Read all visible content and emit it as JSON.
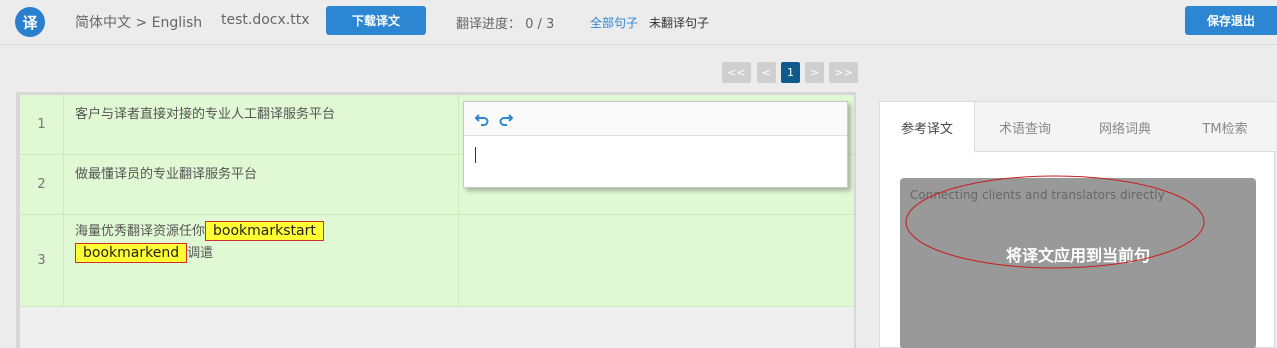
{
  "header": {
    "logo_char": "译",
    "lang_pair": "简体中文 > English",
    "filename": "test.docx.ttx",
    "download_label": "下载译文",
    "progress": "翻译进度： 0 / 3",
    "filter_all": "全部句子",
    "filter_untranslated": "未翻译句子",
    "save_exit_label": "保存退出"
  },
  "pagination": {
    "first": "<<",
    "prev": "<",
    "current": "1",
    "next": ">",
    "last": ">>"
  },
  "segments": [
    {
      "num": "1",
      "source": "客户与译者直接对接的专业人工翻译服务平台"
    },
    {
      "num": "2",
      "source": "做最懂译员的专业翻译服务平台"
    },
    {
      "num": "3",
      "source_before": "海量优秀翻译资源任你",
      "bookmark_start": "bookmarkstart",
      "bookmark_end": "bookmarkend",
      "source_after": "调遣"
    }
  ],
  "editor": {
    "undo_icon": "undo-icon",
    "redo_icon": "redo-icon"
  },
  "right_panel": {
    "tabs": [
      "参考译文",
      "术语查询",
      "网络词典",
      "TM检索"
    ],
    "active_tab": "参考译文",
    "reference_text": "Connecting clients and translators directly",
    "apply_label": "将译文应用到当前句"
  },
  "colors": {
    "accent": "#2d86d2",
    "row_bg": "#e0f8d3",
    "bookmark_bg": "#ffff33",
    "bookmark_border": "#d12b2b",
    "pager_active": "#0e5a8a"
  }
}
